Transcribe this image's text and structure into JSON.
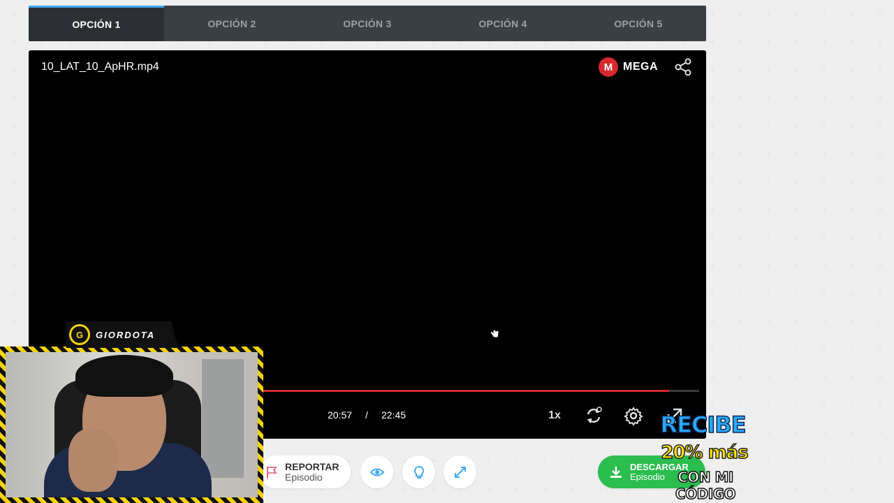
{
  "tabs": [
    {
      "label": "OPCIÓN 1",
      "active": true
    },
    {
      "label": "OPCIÓN 2",
      "active": false
    },
    {
      "label": "OPCIÓN 3",
      "active": false
    },
    {
      "label": "OPCIÓN 4",
      "active": false
    },
    {
      "label": "OPCIÓN 5",
      "active": false
    }
  ],
  "player": {
    "file_name": "10_LAT_10_ApHR.mp4",
    "brand": {
      "icon_letter": "M",
      "name": "MEGA",
      "color": "#d9272e"
    },
    "current_time": "20:57",
    "separator": "/",
    "duration": "22:45",
    "progress_fraction": 0.932,
    "speed": "1x",
    "icons": [
      "share-icon",
      "loop-icon",
      "gear-icon",
      "fullscreen-icon"
    ]
  },
  "actions": {
    "report_title": "REPORTAR",
    "report_sub": "Episodio",
    "download_title": "DESCARGAR",
    "download_sub": "Episodio",
    "download_color": "#2bbd4e"
  },
  "overlay": {
    "streamer_logo": "G",
    "streamer_name": "GIORDOTA",
    "promo_line1": "RECIBE",
    "promo_line2": "20% más",
    "promo_line3": "CON MI CÓDIGO"
  }
}
